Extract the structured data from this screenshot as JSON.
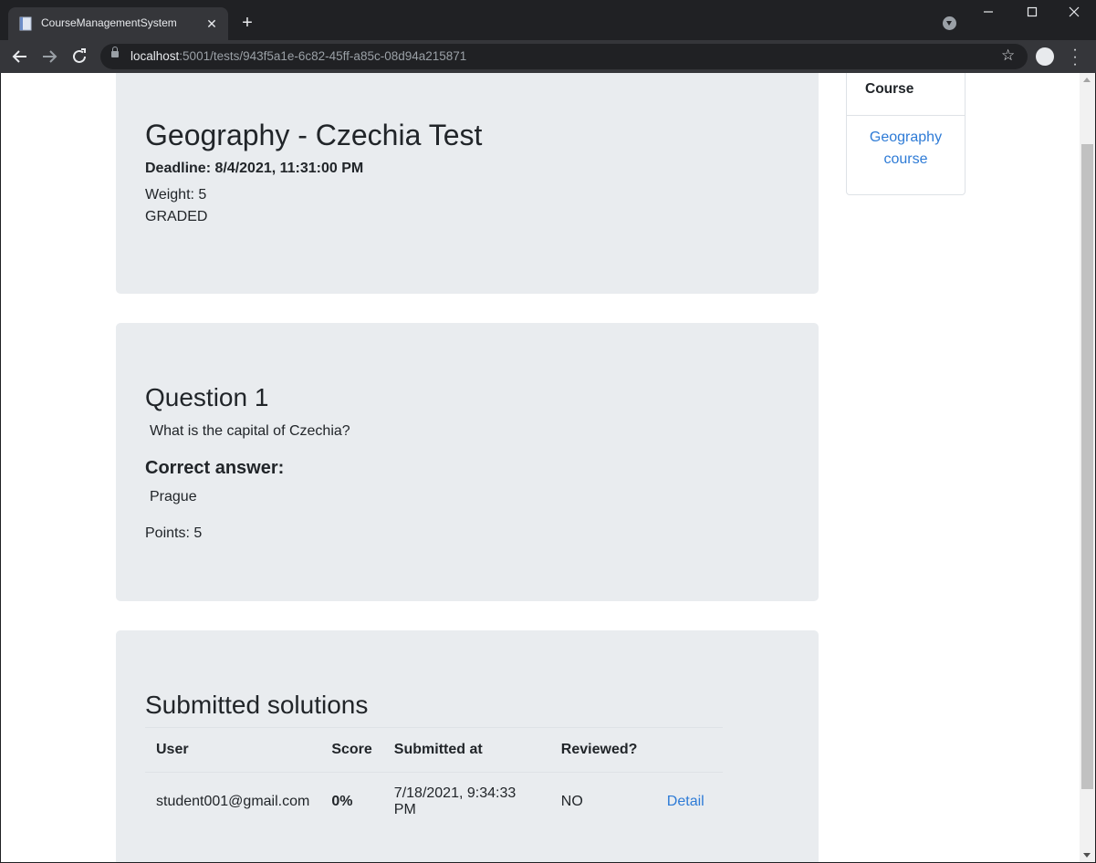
{
  "browser": {
    "tab_title": "CourseManagementSystem",
    "url_host": "localhost",
    "url_path": ":5001/tests/943f5a1e-6c82-45ff-a85c-08d94a215871"
  },
  "test": {
    "title": "Geography - Czechia Test",
    "deadline": "Deadline: 8/4/2021, 11:31:00 PM",
    "weight": "Weight: 5",
    "status": "GRADED"
  },
  "question": {
    "title": "Question 1",
    "text": "What is the capital of Czechia?",
    "correct_heading": "Correct answer:",
    "correct_answer": "Prague",
    "points": "Points: 5"
  },
  "solutions": {
    "title": "Submitted solutions",
    "columns": [
      "User",
      "Score",
      "Submitted at",
      "Reviewed?",
      ""
    ],
    "rows": [
      {
        "user": "student001@gmail.com",
        "score": "0%",
        "submitted_at": "7/18/2021, 9:34:33 PM",
        "reviewed": "NO",
        "action": "Detail"
      }
    ]
  },
  "sidebar": {
    "header": "Course",
    "link": "Geography course"
  }
}
